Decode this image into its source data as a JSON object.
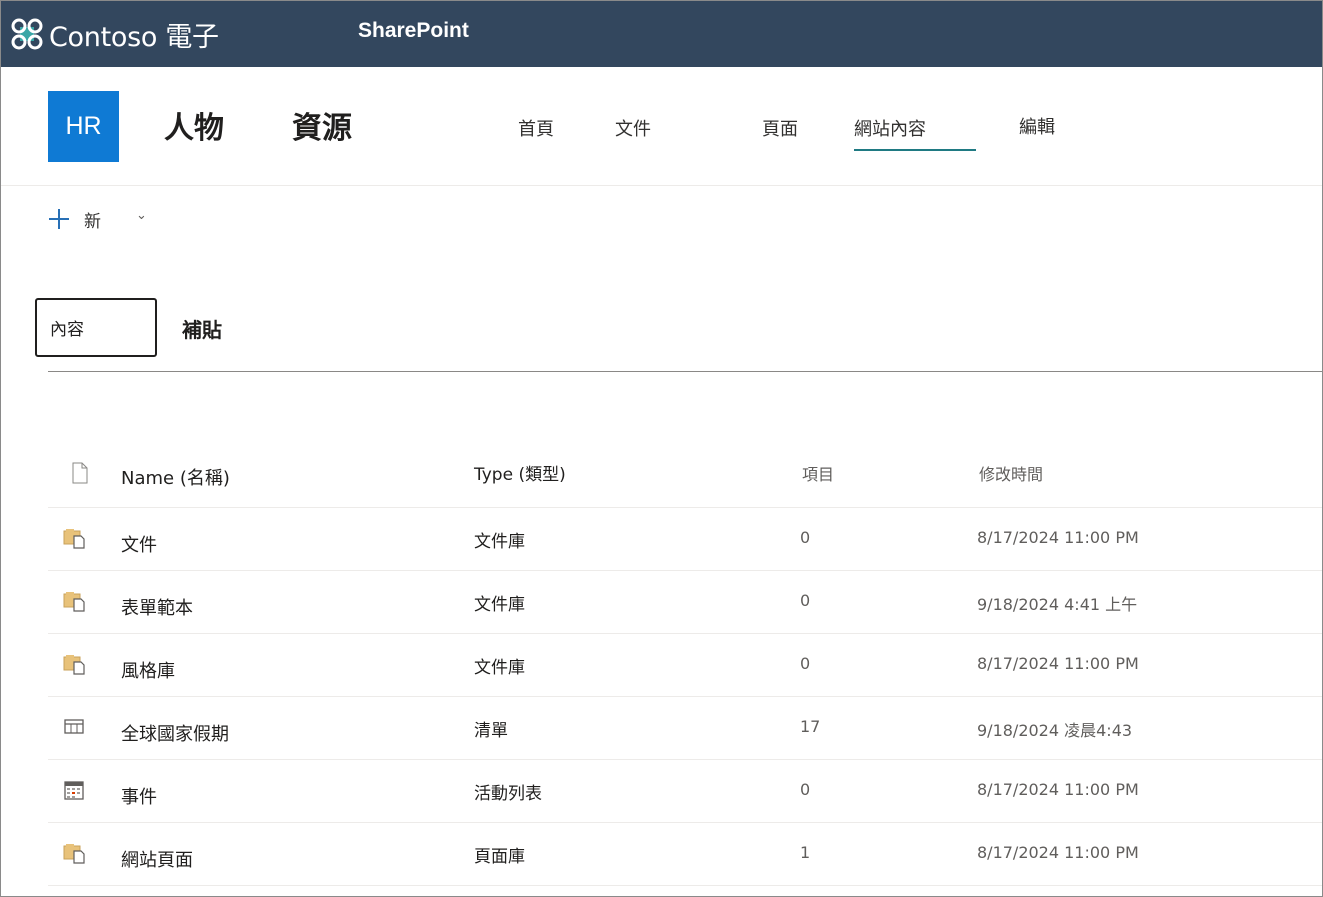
{
  "suite_bar": {
    "brand_name": "Contoso 電子",
    "app_name": "SharePoint",
    "logo_icon": "contoso-logo-icon"
  },
  "site": {
    "logo_text": "HR",
    "title_part1": "人物",
    "title_part2": "資源",
    "logo_color": "#0f7ad4",
    "nav": [
      {
        "label": "首頁",
        "active": false
      },
      {
        "label": "文件",
        "active": false
      },
      {
        "label": "頁面",
        "active": false
      },
      {
        "label": "網站內容",
        "active": true
      },
      {
        "label": "編輯",
        "active": false
      }
    ]
  },
  "command_bar": {
    "new_label": "新",
    "new_icon": "plus-icon",
    "dropdown_icon": "chevron-down-icon"
  },
  "pivot": {
    "tabs": [
      {
        "label": "內容",
        "selected": true
      },
      {
        "label": "補貼",
        "selected": false
      }
    ]
  },
  "table": {
    "headers": {
      "icon": "document-icon",
      "name": "Name (名稱)",
      "type": "Type (類型)",
      "items": "項目",
      "modified": "修改時間"
    },
    "rows": [
      {
        "icon": "document-library-icon",
        "name": "文件",
        "type": "文件庫",
        "items": "0",
        "modified": "8/17/2024 11:00 PM"
      },
      {
        "icon": "document-library-icon",
        "name": "表單範本",
        "type": "文件庫",
        "items": "0",
        "modified": "9/18/2024 4:41 上午"
      },
      {
        "icon": "document-library-icon",
        "name": "風格庫",
        "type": "文件庫",
        "items": "0",
        "modified": "8/17/2024 11:00 PM"
      },
      {
        "icon": "list-icon",
        "name": "全球國家假期",
        "type": "清單",
        "items": "17",
        "modified": "9/18/2024 凌晨4:43"
      },
      {
        "icon": "calendar-icon",
        "name": "事件",
        "type": "活動列表",
        "items": "0",
        "modified": "8/17/2024 11:00 PM"
      },
      {
        "icon": "document-library-icon",
        "name": "網站頁面",
        "type": "頁面庫",
        "items": "1",
        "modified": "8/17/2024 11:00 PM"
      }
    ]
  },
  "colors": {
    "suite_bar": "#33475e",
    "accent": "#1f7a83",
    "plus": "#2870b6",
    "folder": "#d8a657"
  }
}
